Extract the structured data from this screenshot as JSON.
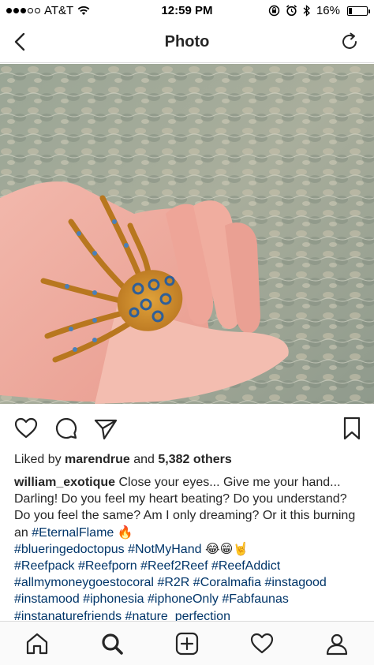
{
  "status_bar": {
    "carrier": "AT&T",
    "time": "12:59 PM",
    "battery_percent": "16%",
    "battery_level": 0.16,
    "signal_bars_filled": 3,
    "signal_bars_total": 5
  },
  "nav": {
    "title": "Photo",
    "back_icon": "chevron-left-icon",
    "refresh_icon": "refresh-icon"
  },
  "photo": {
    "subject": "image"
  },
  "actions": {
    "like_icon": "heart-icon",
    "comment_icon": "comment-icon",
    "share_icon": "send-icon",
    "save_icon": "bookmark-icon"
  },
  "likes": {
    "prefix": "Liked by",
    "user": "marendrue",
    "middle": "and",
    "others": "5,382 others"
  },
  "caption": {
    "username": "william_exotique",
    "text": " Close your eyes... Give me your hand... Darling! Do you feel my heart beating? Do you understand? Do you feel the same? Am I only dreaming? Or it this burning an ",
    "tag_eternal": "#EternalFlame",
    "emoji_fire": " 🔥",
    "tags_line1": [
      "#blueringedoctopus",
      "#NotMyHand"
    ],
    "emoji_line1": " 😂😁🤘",
    "tags_rest": [
      "#Reefpack",
      "#Reefporn",
      "#Reef2Reef",
      "#ReefAddict",
      "#allmymoneygoestocoral",
      "#R2R",
      "#Coralmafia",
      "#instagood",
      "#instamood",
      "#iphonesia",
      "#iphoneOnly",
      "#Fabfaunas",
      "#instanaturefriends",
      "#nature_perfection"
    ]
  },
  "tabs": [
    {
      "name": "home-icon"
    },
    {
      "name": "search-icon"
    },
    {
      "name": "add-post-icon"
    },
    {
      "name": "activity-heart-icon"
    },
    {
      "name": "profile-icon"
    }
  ],
  "colors": {
    "text": "#262626",
    "hashtag": "#003569",
    "divider": "#dbdbdb"
  }
}
